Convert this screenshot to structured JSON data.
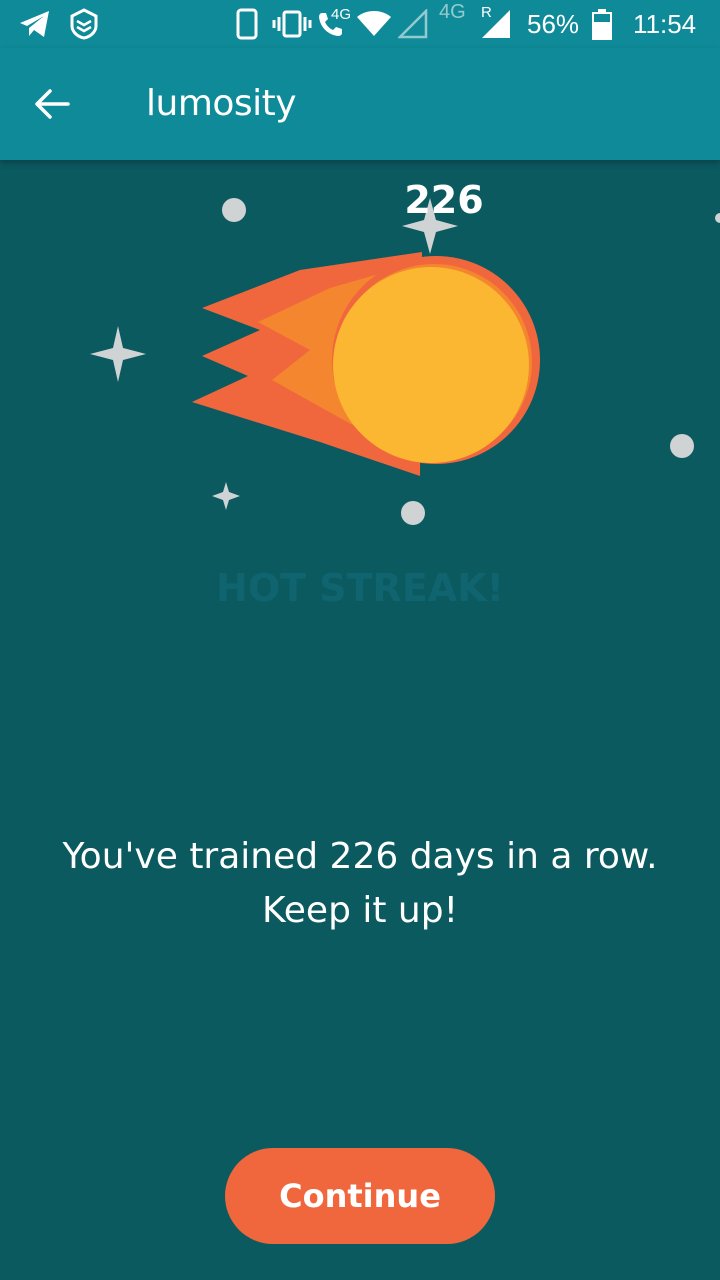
{
  "status_bar": {
    "network_label": "4G",
    "network2_label": "4G",
    "roaming_label": "R",
    "battery": "56%",
    "time": "11:54"
  },
  "app_bar": {
    "title": "lumosity",
    "back_icon": "arrow-left-icon"
  },
  "streak": {
    "days": "226",
    "label": "HOT STREAK!"
  },
  "message": "You've trained 226 days in a row. Keep it up!",
  "continue_label": "Continue",
  "colors": {
    "background": "#0b5a60",
    "app_bar": "#0f8a98",
    "accent": "#f0673d",
    "fireball_core": "#fbb731",
    "fireball_flame": "#f0673d"
  }
}
